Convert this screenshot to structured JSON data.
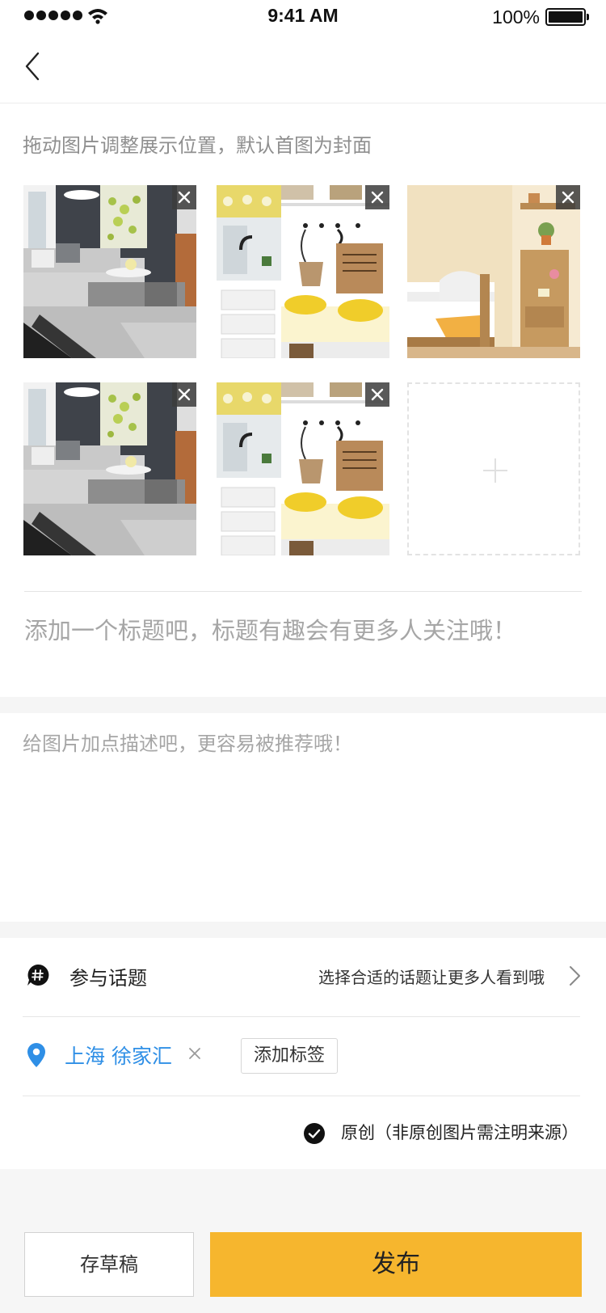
{
  "status_bar": {
    "time": "9:41 AM",
    "battery": "100%",
    "icons": [
      "signal-dots-icon",
      "wifi-icon",
      "battery-icon"
    ]
  },
  "nav": {
    "back_icon": "chevron-left-icon"
  },
  "upload": {
    "hint": "拖动图片调整展示位置，默认首图为封面",
    "photos": [
      {
        "scene": "living-room"
      },
      {
        "scene": "entryway-bench"
      },
      {
        "scene": "bedroom"
      },
      {
        "scene": "living-room"
      },
      {
        "scene": "entryway-bench"
      }
    ],
    "remove_icon": "close-icon",
    "add_icon": "plus-icon"
  },
  "title_field": {
    "placeholder": "添加一个标题吧，标题有趣会有更多人关注哦！"
  },
  "description_field": {
    "placeholder": "给图片加点描述吧，更容易被推荐哦！"
  },
  "topic": {
    "icon": "hashtag-chat-icon",
    "label": "参与话题",
    "hint": "选择合适的话题让更多人看到哦"
  },
  "location": {
    "icon": "location-pin-icon",
    "text": "上海 徐家汇",
    "clear_icon": "close-icon",
    "add_tag_label": "添加标签"
  },
  "original": {
    "checked": true,
    "label": "原创（非原创图片需注明来源）"
  },
  "actions": {
    "draft_label": "存草稿",
    "publish_label": "发布"
  },
  "colors": {
    "accent": "#f6b62e",
    "location_blue": "#2f8fe6",
    "placeholder": "#a6a6a6",
    "divider": "#e6e6e6"
  }
}
